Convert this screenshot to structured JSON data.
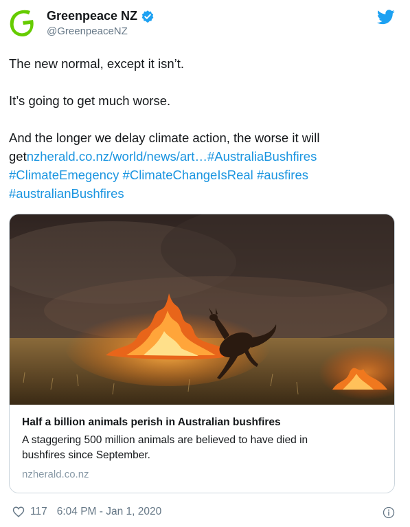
{
  "author": {
    "display_name": "Greenpeace NZ",
    "handle": "@GreenpeaceNZ",
    "verified": true,
    "brand_color": "#66cc00"
  },
  "tweet": {
    "line1": "The new normal, except it isn’t.",
    "line2": "It’s going to get much worse.",
    "line3_text": "And the longer we delay climate action, the worse it will get",
    "link_url": "nzherald.co.nz/world/news/art…",
    "hashtags": [
      "#AustraliaBushfires",
      "#ClimateEmegency",
      "#ClimateChangeIsReal",
      "#ausfires",
      "#australianBushfires"
    ]
  },
  "card": {
    "title": "Half a billion animals perish in Australian bushfires",
    "description": "A staggering 500 million animals are believed to have died in bushfires since September.",
    "domain": "nzherald.co.nz"
  },
  "footer": {
    "like_count": "117",
    "timestamp": "6:04 PM - Jan 1, 2020"
  },
  "colors": {
    "link": "#1b95e0",
    "twitter_blue": "#1da1f2",
    "muted": "#657786"
  },
  "icons": [
    "greenpeace-logo",
    "verified-badge-icon",
    "twitter-bird-icon",
    "heart-icon",
    "info-icon"
  ]
}
